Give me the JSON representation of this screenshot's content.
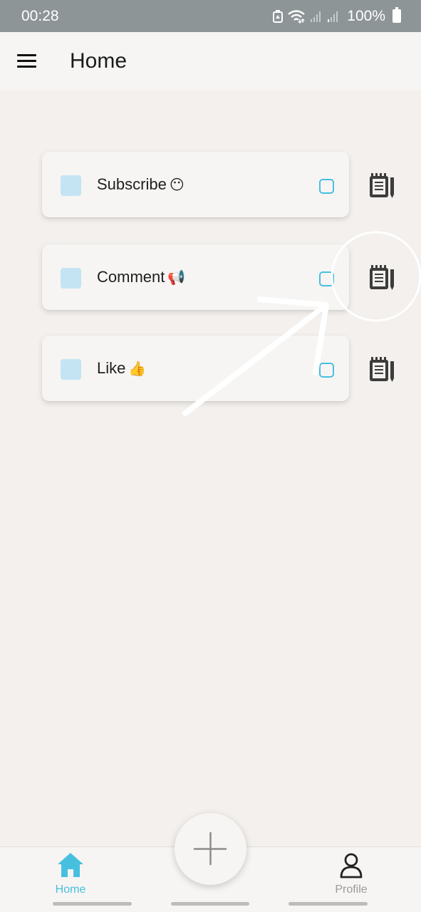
{
  "status_bar": {
    "time": "00:28",
    "battery": "100%",
    "icons": [
      "battery-saver-icon",
      "wifi-icon",
      "signal-icon",
      "signal-icon",
      "battery-icon"
    ]
  },
  "app_bar": {
    "title": "Home",
    "menu_icon": "hamburger-menu-icon"
  },
  "tasks": [
    {
      "label": "Subscribe",
      "emoji": "😶",
      "checked": false,
      "notes_icon": "notes-icon"
    },
    {
      "label": "Comment",
      "emoji": "📢",
      "checked": false,
      "notes_icon": "notes-icon"
    },
    {
      "label": "Like",
      "emoji": "👍",
      "checked": false,
      "notes_icon": "notes-icon"
    }
  ],
  "bottom_nav": {
    "items": [
      {
        "label": "Home",
        "icon": "home-icon",
        "active": true
      },
      {
        "label": "Profile",
        "icon": "profile-icon",
        "active": false
      }
    ],
    "fab_icon": "plus-icon"
  },
  "colors": {
    "accent": "#47c0e0",
    "task_swatch": "#c4e4f3",
    "background": "#f3f0ed",
    "status_bar": "#8e9597"
  }
}
